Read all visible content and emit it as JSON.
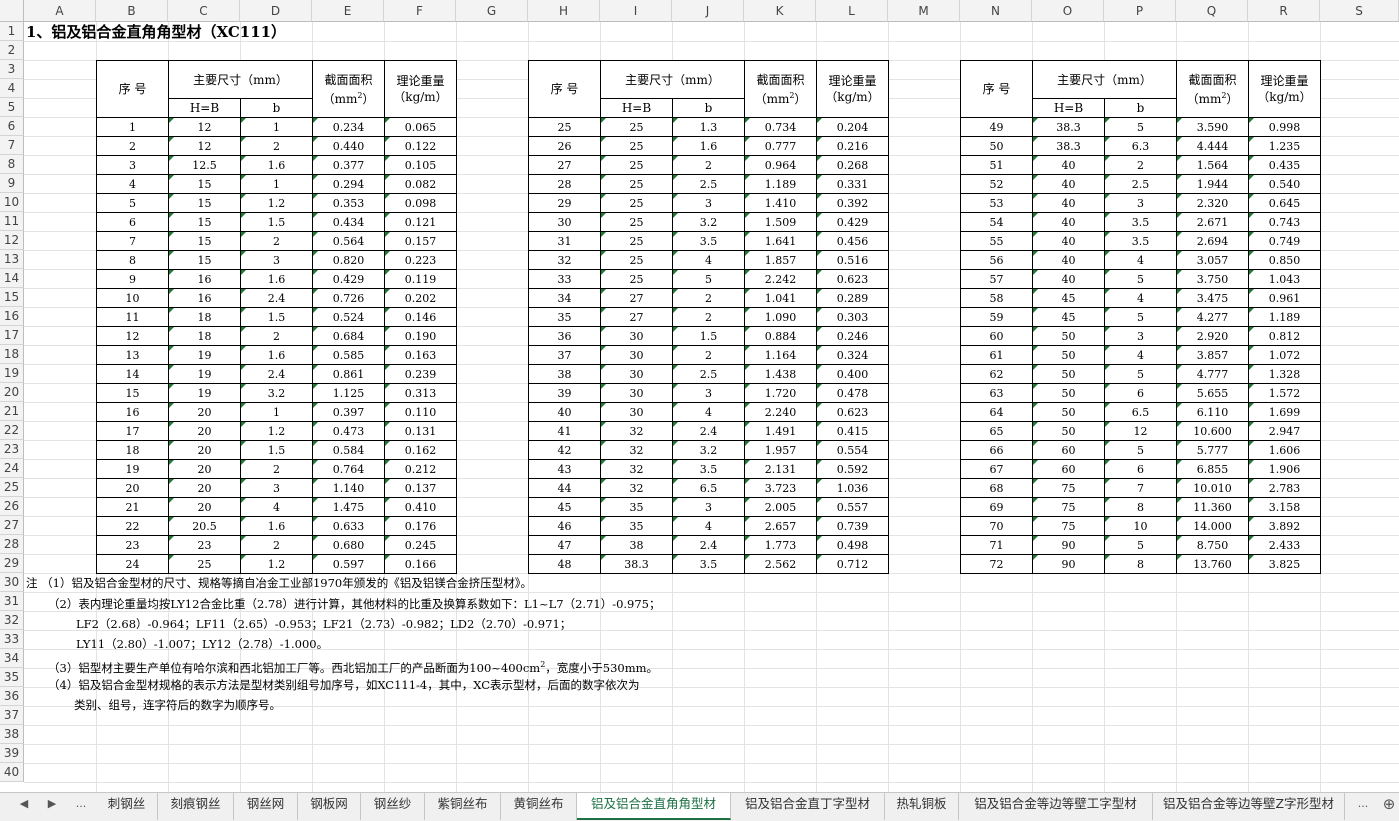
{
  "columns": [
    "A",
    "B",
    "C",
    "D",
    "E",
    "F",
    "G",
    "H",
    "I",
    "J",
    "K",
    "L",
    "M",
    "N",
    "O",
    "P",
    "Q",
    "R",
    "S"
  ],
  "rows": [
    "1",
    "2",
    "3",
    "4",
    "5",
    "6",
    "7",
    "8",
    "9",
    "10",
    "11",
    "12",
    "13",
    "14",
    "15",
    "16",
    "17",
    "18",
    "19",
    "20",
    "21",
    "22",
    "23",
    "24",
    "25",
    "26",
    "27",
    "28",
    "29",
    "30",
    "31",
    "32",
    "33",
    "34",
    "35",
    "36",
    "37",
    "38",
    "39",
    "40"
  ],
  "title": "1、铝及铝合金直角角型材（XC111）",
  "headers": {
    "seq": "序 号",
    "dims": "主要尺寸（mm）",
    "area": "截面面积",
    "area_unit_pre": "（mm",
    "area_unit_sup": "2",
    "area_unit_post": "）",
    "weight": "理论重量",
    "weight_unit": "（kg/m）",
    "hb": "H=B",
    "b": "b"
  },
  "blocks": [
    {
      "rows": [
        [
          "1",
          "12",
          "1",
          "0.234",
          "0.065"
        ],
        [
          "2",
          "12",
          "2",
          "0.440",
          "0.122"
        ],
        [
          "3",
          "12.5",
          "1.6",
          "0.377",
          "0.105"
        ],
        [
          "4",
          "15",
          "1",
          "0.294",
          "0.082"
        ],
        [
          "5",
          "15",
          "1.2",
          "0.353",
          "0.098"
        ],
        [
          "6",
          "15",
          "1.5",
          "0.434",
          "0.121"
        ],
        [
          "7",
          "15",
          "2",
          "0.564",
          "0.157"
        ],
        [
          "8",
          "15",
          "3",
          "0.820",
          "0.223"
        ],
        [
          "9",
          "16",
          "1.6",
          "0.429",
          "0.119"
        ],
        [
          "10",
          "16",
          "2.4",
          "0.726",
          "0.202"
        ],
        [
          "11",
          "18",
          "1.5",
          "0.524",
          "0.146"
        ],
        [
          "12",
          "18",
          "2",
          "0.684",
          "0.190"
        ],
        [
          "13",
          "19",
          "1.6",
          "0.585",
          "0.163"
        ],
        [
          "14",
          "19",
          "2.4",
          "0.861",
          "0.239"
        ],
        [
          "15",
          "19",
          "3.2",
          "1.125",
          "0.313"
        ],
        [
          "16",
          "20",
          "1",
          "0.397",
          "0.110"
        ],
        [
          "17",
          "20",
          "1.2",
          "0.473",
          "0.131"
        ],
        [
          "18",
          "20",
          "1.5",
          "0.584",
          "0.162"
        ],
        [
          "19",
          "20",
          "2",
          "0.764",
          "0.212"
        ],
        [
          "20",
          "20",
          "3",
          "1.140",
          "0.137"
        ],
        [
          "21",
          "20",
          "4",
          "1.475",
          "0.410"
        ],
        [
          "22",
          "20.5",
          "1.6",
          "0.633",
          "0.176"
        ],
        [
          "23",
          "23",
          "2",
          "0.680",
          "0.245"
        ],
        [
          "24",
          "25",
          "1.2",
          "0.597",
          "0.166"
        ]
      ]
    },
    {
      "rows": [
        [
          "25",
          "25",
          "1.3",
          "0.734",
          "0.204"
        ],
        [
          "26",
          "25",
          "1.6",
          "0.777",
          "0.216"
        ],
        [
          "27",
          "25",
          "2",
          "0.964",
          "0.268"
        ],
        [
          "28",
          "25",
          "2.5",
          "1.189",
          "0.331"
        ],
        [
          "29",
          "25",
          "3",
          "1.410",
          "0.392"
        ],
        [
          "30",
          "25",
          "3.2",
          "1.509",
          "0.429"
        ],
        [
          "31",
          "25",
          "3.5",
          "1.641",
          "0.456"
        ],
        [
          "32",
          "25",
          "4",
          "1.857",
          "0.516"
        ],
        [
          "33",
          "25",
          "5",
          "2.242",
          "0.623"
        ],
        [
          "34",
          "27",
          "2",
          "1.041",
          "0.289"
        ],
        [
          "35",
          "27",
          "2",
          "1.090",
          "0.303"
        ],
        [
          "36",
          "30",
          "1.5",
          "0.884",
          "0.246"
        ],
        [
          "37",
          "30",
          "2",
          "1.164",
          "0.324"
        ],
        [
          "38",
          "30",
          "2.5",
          "1.438",
          "0.400"
        ],
        [
          "39",
          "30",
          "3",
          "1.720",
          "0.478"
        ],
        [
          "40",
          "30",
          "4",
          "2.240",
          "0.623"
        ],
        [
          "41",
          "32",
          "2.4",
          "1.491",
          "0.415"
        ],
        [
          "42",
          "32",
          "3.2",
          "1.957",
          "0.554"
        ],
        [
          "43",
          "32",
          "3.5",
          "2.131",
          "0.592"
        ],
        [
          "44",
          "32",
          "6.5",
          "3.723",
          "1.036"
        ],
        [
          "45",
          "35",
          "3",
          "2.005",
          "0.557"
        ],
        [
          "46",
          "35",
          "4",
          "2.657",
          "0.739"
        ],
        [
          "47",
          "38",
          "2.4",
          "1.773",
          "0.498"
        ],
        [
          "48",
          "38.3",
          "3.5",
          "2.562",
          "0.712"
        ]
      ]
    },
    {
      "rows": [
        [
          "49",
          "38.3",
          "5",
          "3.590",
          "0.998"
        ],
        [
          "50",
          "38.3",
          "6.3",
          "4.444",
          "1.235"
        ],
        [
          "51",
          "40",
          "2",
          "1.564",
          "0.435"
        ],
        [
          "52",
          "40",
          "2.5",
          "1.944",
          "0.540"
        ],
        [
          "53",
          "40",
          "3",
          "2.320",
          "0.645"
        ],
        [
          "54",
          "40",
          "3.5",
          "2.671",
          "0.743"
        ],
        [
          "55",
          "40",
          "3.5",
          "2.694",
          "0.749"
        ],
        [
          "56",
          "40",
          "4",
          "3.057",
          "0.850"
        ],
        [
          "57",
          "40",
          "5",
          "3.750",
          "1.043"
        ],
        [
          "58",
          "45",
          "4",
          "3.475",
          "0.961"
        ],
        [
          "59",
          "45",
          "5",
          "4.277",
          "1.189"
        ],
        [
          "60",
          "50",
          "3",
          "2.920",
          "0.812"
        ],
        [
          "61",
          "50",
          "4",
          "3.857",
          "1.072"
        ],
        [
          "62",
          "50",
          "5",
          "4.777",
          "1.328"
        ],
        [
          "63",
          "50",
          "6",
          "5.655",
          "1.572"
        ],
        [
          "64",
          "50",
          "6.5",
          "6.110",
          "1.699"
        ],
        [
          "65",
          "50",
          "12",
          "10.600",
          "2.947"
        ],
        [
          "66",
          "60",
          "5",
          "5.777",
          "1.606"
        ],
        [
          "67",
          "60",
          "6",
          "6.855",
          "1.906"
        ],
        [
          "68",
          "75",
          "7",
          "10.010",
          "2.783"
        ],
        [
          "69",
          "75",
          "8",
          "11.360",
          "3.158"
        ],
        [
          "70",
          "75",
          "10",
          "14.000",
          "3.892"
        ],
        [
          "71",
          "90",
          "5",
          "8.750",
          "2.433"
        ],
        [
          "72",
          "90",
          "8",
          "13.760",
          "3.825"
        ]
      ]
    }
  ],
  "notes": [
    "注 （1）铝及铝合金型材的尺寸、规格等摘自冶金工业部1970年颁发的《铝及铝镁合金挤压型材》。",
    "（2）表内理论重量均按LY12合金比重（2.78）进行计算，其他材料的比重及换算系数如下：L1~L7（2.71）-0.975；",
    "LF2（2.68）-0.964；LF11（2.65）-0.953；LF21（2.73）-0.982；LD2（2.70）-0.971；",
    "LY11（2.80）-1.007；LY12（2.78）-1.000。",
    "（3）铝型材主要生产单位有哈尔滨和西北铝加工厂等。西北铝加工厂的产品断面为100~400cm",
    "2",
    "，宽度小于530mm。",
    "（4）铝及铝合金型材规格的表示方法是型材类别组号加序号，如XC111-4，其中，XC表示型材，后面的数字依次为",
    "类别、组号，连字符后的数字为顺序号。"
  ],
  "nav": {
    "prev": "◀",
    "next": "▶",
    "more_left": "...",
    "more_right": "...",
    "add": "⊕"
  },
  "tabs": [
    "刺钢丝",
    "刻痕钢丝",
    "钢丝网",
    "钢板网",
    "钢丝纱",
    "紫铜丝布",
    "黄铜丝布",
    "铝及铝合金直角角型材",
    "铝及铝合金直丁字型材",
    "热轧铜板",
    "铝及铝合金等边等壁工字型材",
    "铝及铝合金等边等壁Z字形型材"
  ],
  "active_tab": 7,
  "colors": {
    "accent": "#1e7145",
    "triangle": "#1e7a33"
  }
}
